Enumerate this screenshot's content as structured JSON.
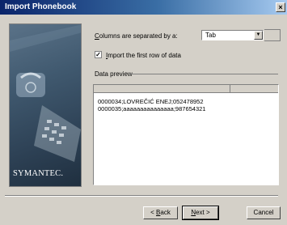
{
  "window": {
    "title": "Import Phonebook",
    "close_glyph": "×"
  },
  "banner": {
    "brand": "SYMANTEC."
  },
  "separator": {
    "label_prefix": "C",
    "label_rest": "olumns are separated by a:",
    "selected": "Tab",
    "arrow_glyph": "▼"
  },
  "first_row": {
    "checked_glyph": "✓",
    "label_prefix": "I",
    "label_rest": "mport the first row of data"
  },
  "preview": {
    "heading": "Data preview",
    "rows": [
      "0000034;LOVREČIĆ  ENEJ;052478952",
      "0000035;aaaaaaaaaaaaaaa;987654321"
    ]
  },
  "buttons": {
    "back_prefix": "< ",
    "back_u": "B",
    "back_rest": "ack",
    "next_u": "N",
    "next_rest": "ext >",
    "cancel": "Cancel"
  }
}
